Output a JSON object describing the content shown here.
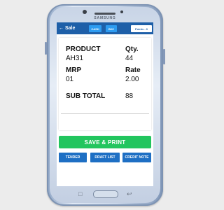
{
  "device": {
    "brand": "SAMSUNG"
  },
  "appbar": {
    "back_icon": "arrow-left-icon",
    "title": "Sale",
    "tabs": [
      {
        "label": "CASH"
      },
      {
        "label": "B2C"
      }
    ],
    "points_label": "Points - 0"
  },
  "item": {
    "product_label": "PRODUCT",
    "product_value": "AH31",
    "qty_label": "Qty.",
    "qty_value": "44",
    "mrp_label": "MRP",
    "mrp_value": "01",
    "rate_label": "Rate",
    "rate_value": "2.00",
    "subtotal_label": "SUB TOTAL",
    "subtotal_value": "88"
  },
  "actions": {
    "save_print": "SAVE & PRINT",
    "tender": "TENDER",
    "draft_list": "DRAFT LIST",
    "credit_note": "CREDIT NOTE"
  },
  "colors": {
    "appbar": "#1e5fa8",
    "chip": "#2d9bf0",
    "save_button": "#22c55e",
    "action_button": "#1e6fc4",
    "background": "#ececec"
  }
}
